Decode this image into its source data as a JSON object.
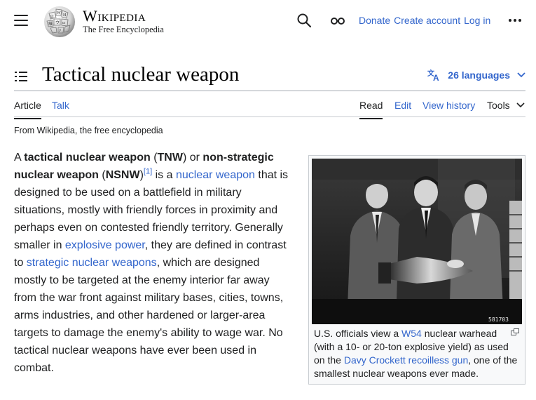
{
  "header": {
    "wordmark_title": "Wikipedia",
    "wordmark_tagline": "The Free Encyclopedia",
    "links": [
      "Donate",
      "Create account",
      "Log in"
    ]
  },
  "title_row": {
    "title": "Tactical nuclear weapon",
    "languages_label": "26 languages"
  },
  "tabs": {
    "article": "Article",
    "talk": "Talk",
    "read": "Read",
    "edit": "Edit",
    "view_history": "View history",
    "tools": "Tools"
  },
  "from_wiki": "From Wikipedia, the free encyclopedia",
  "article": {
    "a": "A ",
    "tnw_bold": "tactical nuclear weapon",
    "p1": " (",
    "tnw_abbr": "TNW",
    "p2": ") or ",
    "nsnw_bold": "non-strategic nuclear weapon",
    "p3": " (",
    "nsnw_abbr": "NSNW",
    "p4": ")",
    "ref": "[1]",
    "p5": " is a ",
    "link_nuclear_weapon": "nuclear weapon",
    "p6": " that is designed to be used on a battlefield in military situations, mostly with friendly forces in proximity and perhaps even on contested friendly territory. Generally smaller in ",
    "link_explosive_power": "explosive power",
    "p7": ", they are defined in contrast to ",
    "link_strategic": "strategic nuclear weapons",
    "p8": ", which are designed mostly to be targeted at the enemy interior far away from the war front against military bases, cities, towns, arms industries, and other hardened or larger-area targets to damage the enemy's ability to wage war. No tactical nuclear weapons have ever been used in combat."
  },
  "image": {
    "photo_number": "581703",
    "caption_1": "U.S. officials view a ",
    "caption_link_w54": "W54",
    "caption_2": " nuclear warhead (with a 10- or 20-ton explosive yield) as used on the ",
    "caption_link_davy": "Davy Crockett recoilless gun",
    "caption_3": ", one of the smallest nuclear weapons ever made."
  }
}
